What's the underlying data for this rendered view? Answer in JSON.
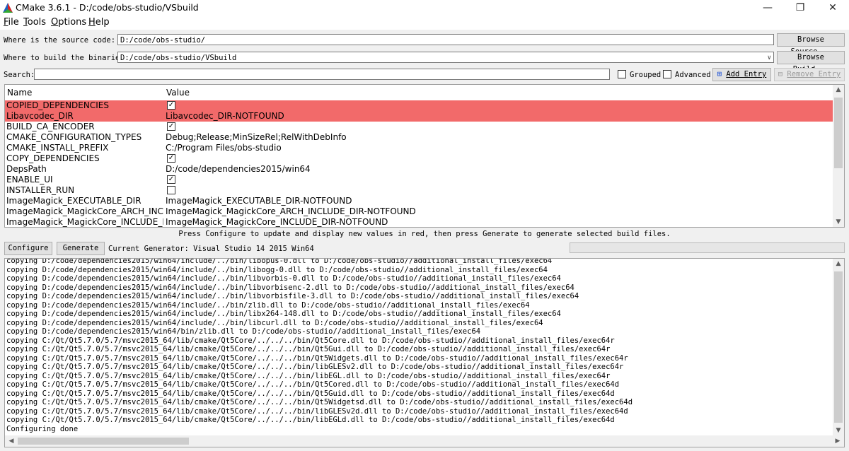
{
  "window": {
    "title": "CMake 3.6.1 - D:/code/obs-studio/VSbuild",
    "minimize_icon": "minimize-icon",
    "maximize_icon": "maximize-icon",
    "close_icon": "close-icon"
  },
  "menu": [
    {
      "key": "F",
      "rest": "ile"
    },
    {
      "key": "T",
      "rest": "ools"
    },
    {
      "key": "O",
      "rest": "ptions"
    },
    {
      "key": "H",
      "rest": "elp"
    }
  ],
  "source": {
    "label": "Where is the source code:",
    "value": "D:/code/obs-studio/",
    "button": "Browse Source..."
  },
  "build": {
    "label": "Where to build the binaries:",
    "value": "D:/code/obs-studio/VSbuild",
    "button": "Browse Build..."
  },
  "search": {
    "label": "Search:",
    "value": "",
    "grouped": "Grouped",
    "advanced": "Advanced",
    "add_entry": "Add Entry",
    "remove_entry": "Remove Entry"
  },
  "table": {
    "headers": [
      "Name",
      "Value"
    ],
    "rows": [
      {
        "name": "COPIED_DEPENDENCIES",
        "type": "check",
        "checked": true,
        "value": "",
        "highlight": true
      },
      {
        "name": "Libavcodec_DIR",
        "type": "text",
        "value": "Libavcodec_DIR-NOTFOUND",
        "highlight": true
      },
      {
        "name": "BUILD_CA_ENCODER",
        "type": "check",
        "checked": true,
        "value": "",
        "highlight": false
      },
      {
        "name": "CMAKE_CONFIGURATION_TYPES",
        "type": "text",
        "value": "Debug;Release;MinSizeRel;RelWithDebInfo",
        "highlight": false
      },
      {
        "name": "CMAKE_INSTALL_PREFIX",
        "type": "text",
        "value": "C:/Program Files/obs-studio",
        "highlight": false
      },
      {
        "name": "COPY_DEPENDENCIES",
        "type": "check",
        "checked": true,
        "value": "",
        "highlight": false
      },
      {
        "name": "DepsPath",
        "type": "text",
        "value": "D:/code/dependencies2015/win64",
        "highlight": false
      },
      {
        "name": "ENABLE_UI",
        "type": "check",
        "checked": true,
        "value": "",
        "highlight": false
      },
      {
        "name": "INSTALLER_RUN",
        "type": "check",
        "checked": false,
        "value": "",
        "highlight": false
      },
      {
        "name": "ImageMagick_EXECUTABLE_DIR",
        "type": "text",
        "value": "ImageMagick_EXECUTABLE_DIR-NOTFOUND",
        "highlight": false
      },
      {
        "name": "ImageMagick_MagickCore_ARCH_INCL...",
        "type": "text",
        "value": "ImageMagick_MagickCore_ARCH_INCLUDE_DIR-NOTFOUND",
        "highlight": false
      },
      {
        "name": "ImageMagick_MagickCore_INCLUDE_D...",
        "type": "text",
        "value": "ImageMagick_MagickCore_INCLUDE_DIR-NOTFOUND",
        "highlight": false
      }
    ]
  },
  "hint": "Press Configure to update and display new values in red, then press Generate to generate selected build files.",
  "actions": {
    "configure": "Configure",
    "generate": "Generate",
    "generator": "Current Generator: Visual Studio 14 2015 Win64"
  },
  "log": [
    "copying D:/code/dependencies2015/win64/include/../bin/libopus-0.dll to D:/code/obs-studio//additional_install_files/exec64",
    "copying D:/code/dependencies2015/win64/include/../bin/libogg-0.dll to D:/code/obs-studio//additional_install_files/exec64",
    "copying D:/code/dependencies2015/win64/include/../bin/libvorbis-0.dll to D:/code/obs-studio//additional_install_files/exec64",
    "copying D:/code/dependencies2015/win64/include/../bin/libvorbisenc-2.dll to D:/code/obs-studio//additional_install_files/exec64",
    "copying D:/code/dependencies2015/win64/include/../bin/libvorbisfile-3.dll to D:/code/obs-studio//additional_install_files/exec64",
    "copying D:/code/dependencies2015/win64/include/../bin/zlib.dll to D:/code/obs-studio//additional_install_files/exec64",
    "copying D:/code/dependencies2015/win64/include/../bin/libx264-148.dll to D:/code/obs-studio//additional_install_files/exec64",
    "copying D:/code/dependencies2015/win64/include/../bin/libcurl.dll to D:/code/obs-studio//additional_install_files/exec64",
    "copying D:/code/dependencies2015/win64/bin/zlib.dll to D:/code/obs-studio//additional_install_files/exec64",
    "copying C:/Qt/Qt5.7.0/5.7/msvc2015_64/lib/cmake/Qt5Core/../../../bin/Qt5Core.dll to D:/code/obs-studio//additional_install_files/exec64r",
    "copying C:/Qt/Qt5.7.0/5.7/msvc2015_64/lib/cmake/Qt5Core/../../../bin/Qt5Gui.dll to D:/code/obs-studio//additional_install_files/exec64r",
    "copying C:/Qt/Qt5.7.0/5.7/msvc2015_64/lib/cmake/Qt5Core/../../../bin/Qt5Widgets.dll to D:/code/obs-studio//additional_install_files/exec64r",
    "copying C:/Qt/Qt5.7.0/5.7/msvc2015_64/lib/cmake/Qt5Core/../../../bin/libGLESv2.dll to D:/code/obs-studio//additional_install_files/exec64r",
    "copying C:/Qt/Qt5.7.0/5.7/msvc2015_64/lib/cmake/Qt5Core/../../../bin/libEGL.dll to D:/code/obs-studio//additional_install_files/exec64r",
    "copying C:/Qt/Qt5.7.0/5.7/msvc2015_64/lib/cmake/Qt5Core/../../../bin/Qt5Cored.dll to D:/code/obs-studio//additional_install_files/exec64d",
    "copying C:/Qt/Qt5.7.0/5.7/msvc2015_64/lib/cmake/Qt5Core/../../../bin/Qt5Guid.dll to D:/code/obs-studio//additional_install_files/exec64d",
    "copying C:/Qt/Qt5.7.0/5.7/msvc2015_64/lib/cmake/Qt5Core/../../../bin/Qt5Widgetsd.dll to D:/code/obs-studio//additional_install_files/exec64d",
    "copying C:/Qt/Qt5.7.0/5.7/msvc2015_64/lib/cmake/Qt5Core/../../../bin/libGLESv2d.dll to D:/code/obs-studio//additional_install_files/exec64d",
    "copying C:/Qt/Qt5.7.0/5.7/msvc2015_64/lib/cmake/Qt5Core/../../../bin/libEGLd.dll to D:/code/obs-studio//additional_install_files/exec64d",
    "Configuring done"
  ],
  "colors": {
    "highlight": "#f26a6a",
    "background": "#f0f0f0"
  }
}
